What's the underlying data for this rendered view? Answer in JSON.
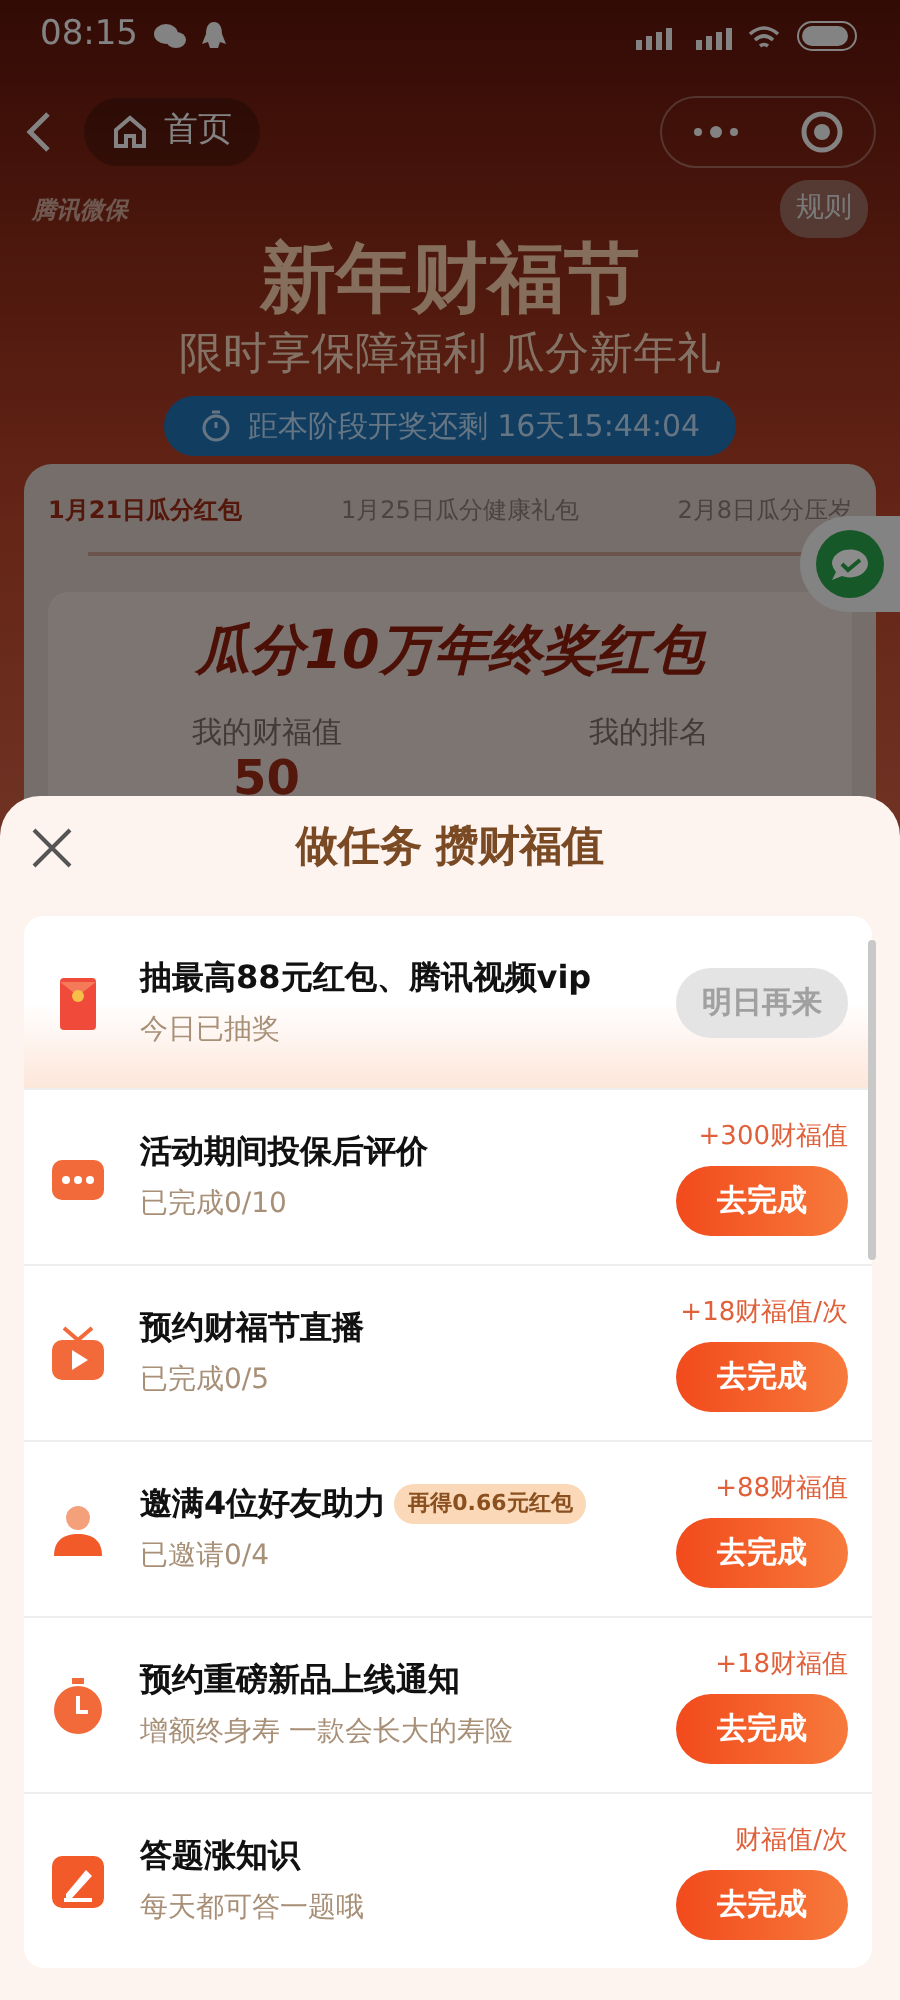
{
  "status_bar": {
    "time": "08:15"
  },
  "nav": {
    "home_label": "首页"
  },
  "banner": {
    "brand": "腾讯微保",
    "rules": "规则",
    "title": "新年财福节",
    "subtitle": "限时享保障福利 瓜分新年礼",
    "countdown": "距本阶段开奖还剩 16天15:44:04"
  },
  "stages": [
    {
      "label": "1月21日瓜分红包",
      "selected": true
    },
    {
      "label": "1月25日瓜分健康礼包",
      "selected": false
    },
    {
      "label": "2月8日瓜分压岁",
      "selected": false
    }
  ],
  "prize": {
    "title": "瓜分10万年终奖红包",
    "my_value_label": "我的财福值",
    "my_value": "50",
    "my_rank_label": "我的排名"
  },
  "sheet": {
    "title": "做任务 攒财福值",
    "tasks": [
      {
        "kind": "lottery",
        "title": "抽最高88元红包、腾讯视频vip",
        "subtitle": "今日已抽奖",
        "button": "明日再来",
        "disabled": true
      },
      {
        "kind": "task",
        "title": "活动期间投保后评价",
        "subtitle": "已完成0/10",
        "reward": "+300财福值",
        "button": "去完成",
        "disabled": false
      },
      {
        "kind": "task",
        "title": "预约财福节直播",
        "subtitle": "已完成0/5",
        "reward": "+18财福值/次",
        "button": "去完成",
        "disabled": false
      },
      {
        "kind": "task",
        "title": "邀满4位好友助力",
        "badge": "再得0.66元红包",
        "subtitle": "已邀请0/4",
        "reward": "+88财福值",
        "button": "去完成",
        "disabled": false
      },
      {
        "kind": "task",
        "title": "预约重磅新品上线通知",
        "subtitle": "增额终身寿 一款会长大的寿险",
        "reward": "+18财福值",
        "button": "去完成",
        "disabled": false
      },
      {
        "kind": "task",
        "title": "答题涨知识",
        "subtitle": "每天都可答一题哦",
        "reward": "财福值/次",
        "button": "去完成",
        "disabled": false
      }
    ]
  }
}
